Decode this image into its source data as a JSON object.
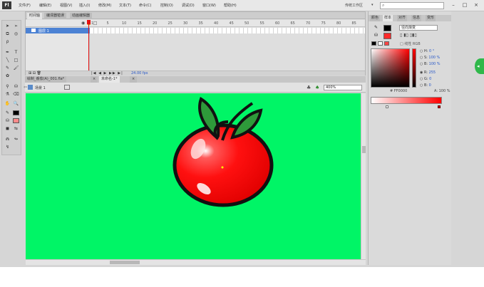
{
  "app": {
    "logo": "Fl",
    "menu": [
      "文件(F)",
      "编辑(E)",
      "视图(V)",
      "插入(I)",
      "修改(M)",
      "文本(T)",
      "命令(C)",
      "控制(O)",
      "调试(D)",
      "窗口(W)",
      "帮助(H)"
    ],
    "workspace": "传统工作区",
    "window_buttons": [
      "–",
      "□",
      "×"
    ]
  },
  "timeline": {
    "tabs": [
      "时间轴",
      "编译器错误",
      "动画编辑器"
    ],
    "layer_name": "图层 1",
    "frame_numbers": [
      "1",
      "5",
      "10",
      "15",
      "20",
      "25",
      "30",
      "35",
      "40",
      "45",
      "50",
      "55",
      "60",
      "65",
      "70",
      "75",
      "80",
      "85"
    ],
    "fps": "24.00 fps"
  },
  "document": {
    "tabs": [
      "绘制_番茄(A)_001.fla*",
      "未命名-1*"
    ],
    "scene": "场景 1",
    "zoom": "400%"
  },
  "color_panel": {
    "tabs": [
      "颜色",
      "样本",
      "对齐",
      "信息",
      "变形"
    ],
    "type": "径向渐变",
    "linear_label": "□ 线性 RGB",
    "hsb": [
      {
        "label": "H:",
        "value": "0 °"
      },
      {
        "label": "S:",
        "value": "100 %"
      },
      {
        "label": "B:",
        "value": "100 %"
      },
      {
        "label": "R:",
        "value": "255"
      },
      {
        "label": "G:",
        "value": "0"
      },
      {
        "label": "B:",
        "value": "0"
      }
    ],
    "alpha": "A: 100 %",
    "hex": "# FF0000",
    "stroke_color": "#000000",
    "fill_color": "#FF2A2A"
  },
  "stage": {
    "background": "#00F566",
    "tomato_color": "#FF0000",
    "leaf_color": "#2E9A3A"
  }
}
